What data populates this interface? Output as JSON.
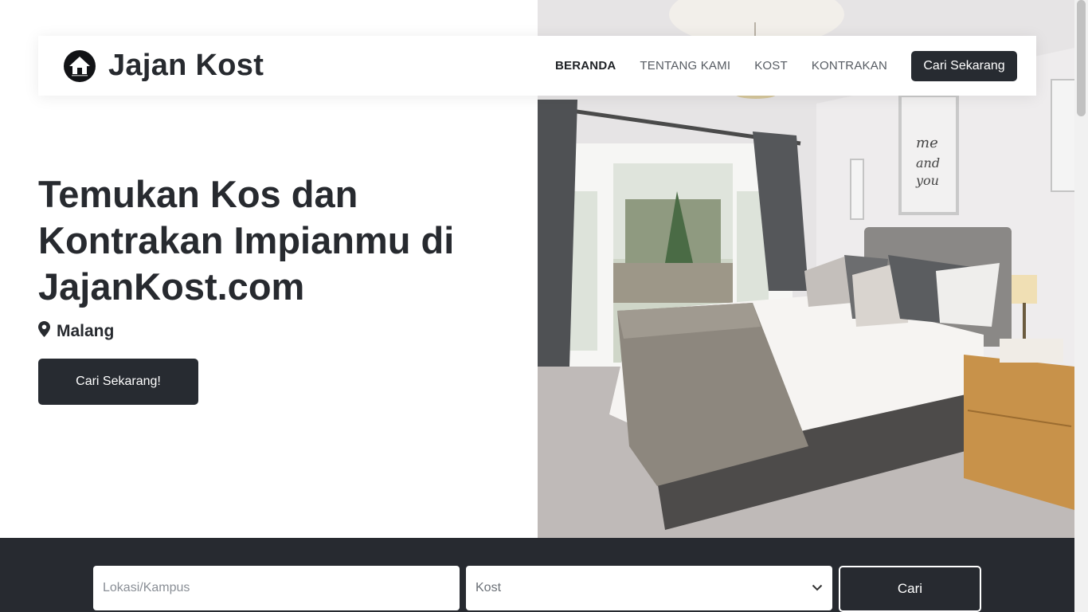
{
  "brand": {
    "name": "Jajan Kost",
    "logo": "house-logo-icon"
  },
  "nav": {
    "items": [
      {
        "label": "BERANDA",
        "active": true
      },
      {
        "label": "TENTANG KAMI",
        "active": false
      },
      {
        "label": "KOST",
        "active": false
      },
      {
        "label": "KONTRAKAN",
        "active": false
      }
    ],
    "cta_label": "Cari Sekarang"
  },
  "hero": {
    "title": "Temukan Kos dan Kontrakan Impianmu di JajanKost.com",
    "location_icon": "map-pin-icon",
    "location": "Malang",
    "button_label": "Cari Sekarang!",
    "image": "bedroom-photo"
  },
  "search": {
    "location_placeholder": "Lokasi/Kampus",
    "type_selected": "Kost",
    "button_label": "Cari"
  },
  "colors": {
    "dark": "#272a30",
    "text": "#272a2f",
    "white": "#ffffff"
  }
}
